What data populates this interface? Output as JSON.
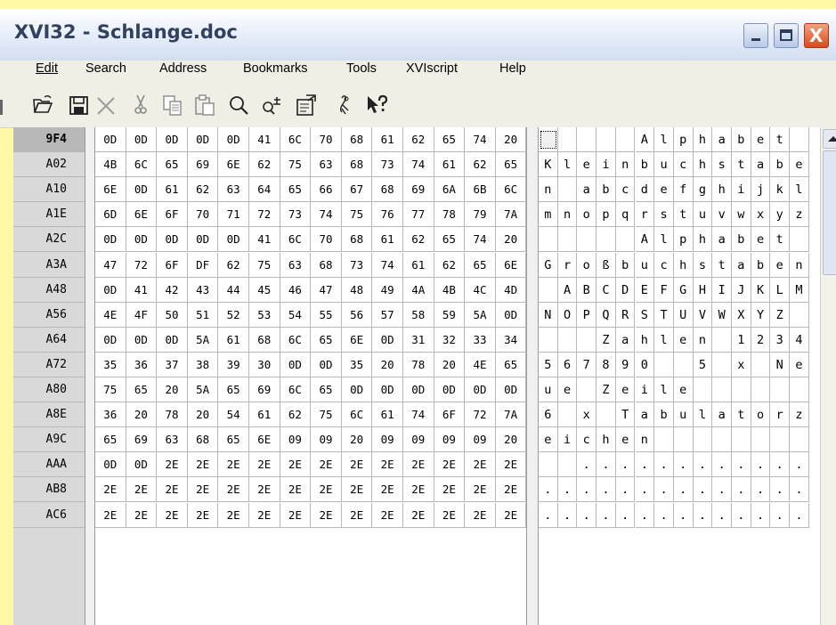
{
  "window": {
    "title": "XVI32 - Schlange.doc",
    "minimize": "minimize",
    "maximize": "maximize",
    "close": "X"
  },
  "menu": [
    {
      "label": "Edit"
    },
    {
      "label": "Search"
    },
    {
      "label": "Address"
    },
    {
      "label": "Bookmarks"
    },
    {
      "label": "Tools"
    },
    {
      "label": "XVIscript"
    },
    {
      "label": "Help"
    }
  ],
  "toolbar": [
    {
      "icon": "open-folder-icon"
    },
    {
      "icon": "save-icon"
    },
    {
      "icon": "delete-icon"
    },
    {
      "icon": "cut-icon"
    },
    {
      "icon": "copy-icon"
    },
    {
      "icon": "paste-icon"
    },
    {
      "icon": "find-icon"
    },
    {
      "icon": "replace-icon"
    },
    {
      "icon": "properties-icon"
    },
    {
      "icon": "info-icon"
    },
    {
      "icon": "context-help-icon"
    }
  ],
  "rows": [
    {
      "addr": "9F4",
      "hex": [
        "0D",
        "0D",
        "0D",
        "0D",
        "0D",
        "41",
        "6C",
        "70",
        "68",
        "61",
        "62",
        "65",
        "74",
        "20"
      ],
      "text": [
        "",
        "",
        "",
        "",
        "",
        "A",
        "l",
        "p",
        "h",
        "a",
        "b",
        "e",
        "t",
        ""
      ]
    },
    {
      "addr": "A02",
      "hex": [
        "4B",
        "6C",
        "65",
        "69",
        "6E",
        "62",
        "75",
        "63",
        "68",
        "73",
        "74",
        "61",
        "62",
        "65"
      ],
      "text": [
        "K",
        "l",
        "e",
        "i",
        "n",
        "b",
        "u",
        "c",
        "h",
        "s",
        "t",
        "a",
        "b",
        "e"
      ]
    },
    {
      "addr": "A10",
      "hex": [
        "6E",
        "0D",
        "61",
        "62",
        "63",
        "64",
        "65",
        "66",
        "67",
        "68",
        "69",
        "6A",
        "6B",
        "6C"
      ],
      "text": [
        "n",
        "",
        "a",
        "b",
        "c",
        "d",
        "e",
        "f",
        "g",
        "h",
        "i",
        "j",
        "k",
        "l"
      ]
    },
    {
      "addr": "A1E",
      "hex": [
        "6D",
        "6E",
        "6F",
        "70",
        "71",
        "72",
        "73",
        "74",
        "75",
        "76",
        "77",
        "78",
        "79",
        "7A"
      ],
      "text": [
        "m",
        "n",
        "o",
        "p",
        "q",
        "r",
        "s",
        "t",
        "u",
        "v",
        "w",
        "x",
        "y",
        "z"
      ]
    },
    {
      "addr": "A2C",
      "hex": [
        "0D",
        "0D",
        "0D",
        "0D",
        "0D",
        "41",
        "6C",
        "70",
        "68",
        "61",
        "62",
        "65",
        "74",
        "20"
      ],
      "text": [
        "",
        "",
        "",
        "",
        "",
        "A",
        "l",
        "p",
        "h",
        "a",
        "b",
        "e",
        "t",
        ""
      ]
    },
    {
      "addr": "A3A",
      "hex": [
        "47",
        "72",
        "6F",
        "DF",
        "62",
        "75",
        "63",
        "68",
        "73",
        "74",
        "61",
        "62",
        "65",
        "6E"
      ],
      "text": [
        "G",
        "r",
        "o",
        "ß",
        "b",
        "u",
        "c",
        "h",
        "s",
        "t",
        "a",
        "b",
        "e",
        "n"
      ]
    },
    {
      "addr": "A48",
      "hex": [
        "0D",
        "41",
        "42",
        "43",
        "44",
        "45",
        "46",
        "47",
        "48",
        "49",
        "4A",
        "4B",
        "4C",
        "4D"
      ],
      "text": [
        "",
        "A",
        "B",
        "C",
        "D",
        "E",
        "F",
        "G",
        "H",
        "I",
        "J",
        "K",
        "L",
        "M"
      ]
    },
    {
      "addr": "A56",
      "hex": [
        "4E",
        "4F",
        "50",
        "51",
        "52",
        "53",
        "54",
        "55",
        "56",
        "57",
        "58",
        "59",
        "5A",
        "0D"
      ],
      "text": [
        "N",
        "O",
        "P",
        "Q",
        "R",
        "S",
        "T",
        "U",
        "V",
        "W",
        "X",
        "Y",
        "Z",
        ""
      ]
    },
    {
      "addr": "A64",
      "hex": [
        "0D",
        "0D",
        "0D",
        "5A",
        "61",
        "68",
        "6C",
        "65",
        "6E",
        "0D",
        "31",
        "32",
        "33",
        "34"
      ],
      "text": [
        "",
        "",
        "",
        "Z",
        "a",
        "h",
        "l",
        "e",
        "n",
        "",
        "1",
        "2",
        "3",
        "4"
      ]
    },
    {
      "addr": "A72",
      "hex": [
        "35",
        "36",
        "37",
        "38",
        "39",
        "30",
        "0D",
        "0D",
        "35",
        "20",
        "78",
        "20",
        "4E",
        "65"
      ],
      "text": [
        "5",
        "6",
        "7",
        "8",
        "9",
        "0",
        "",
        "",
        "5",
        "",
        "x",
        "",
        "N",
        "e"
      ]
    },
    {
      "addr": "A80",
      "hex": [
        "75",
        "65",
        "20",
        "5A",
        "65",
        "69",
        "6C",
        "65",
        "0D",
        "0D",
        "0D",
        "0D",
        "0D",
        "0D"
      ],
      "text": [
        "u",
        "e",
        "",
        "Z",
        "e",
        "i",
        "l",
        "e",
        "",
        "",
        "",
        "",
        "",
        ""
      ]
    },
    {
      "addr": "A8E",
      "hex": [
        "36",
        "20",
        "78",
        "20",
        "54",
        "61",
        "62",
        "75",
        "6C",
        "61",
        "74",
        "6F",
        "72",
        "7A"
      ],
      "text": [
        "6",
        "",
        "x",
        "",
        "T",
        "a",
        "b",
        "u",
        "l",
        "a",
        "t",
        "o",
        "r",
        "z"
      ]
    },
    {
      "addr": "A9C",
      "hex": [
        "65",
        "69",
        "63",
        "68",
        "65",
        "6E",
        "09",
        "09",
        "20",
        "09",
        "09",
        "09",
        "09",
        "20"
      ],
      "text": [
        "e",
        "i",
        "c",
        "h",
        "e",
        "n",
        "",
        "",
        "",
        "",
        "",
        "",
        "",
        ""
      ]
    },
    {
      "addr": "AAA",
      "hex": [
        "0D",
        "0D",
        "2E",
        "2E",
        "2E",
        "2E",
        "2E",
        "2E",
        "2E",
        "2E",
        "2E",
        "2E",
        "2E",
        "2E"
      ],
      "text": [
        "",
        "",
        ".",
        ".",
        ".",
        ".",
        ".",
        ".",
        ".",
        ".",
        ".",
        ".",
        ".",
        "."
      ]
    },
    {
      "addr": "AB8",
      "hex": [
        "2E",
        "2E",
        "2E",
        "2E",
        "2E",
        "2E",
        "2E",
        "2E",
        "2E",
        "2E",
        "2E",
        "2E",
        "2E",
        "2E"
      ],
      "text": [
        ".",
        ".",
        ".",
        ".",
        ".",
        ".",
        ".",
        ".",
        ".",
        ".",
        ".",
        ".",
        ".",
        "."
      ]
    },
    {
      "addr": "AC6",
      "hex": [
        "2E",
        "2E",
        "2E",
        "2E",
        "2E",
        "2E",
        "2E",
        "2E",
        "2E",
        "2E",
        "2E",
        "2E",
        "2E",
        "2E"
      ],
      "text": [
        ".",
        ".",
        ".",
        ".",
        ".",
        ".",
        ".",
        ".",
        ".",
        ".",
        ".",
        ".",
        ".",
        "."
      ]
    }
  ]
}
